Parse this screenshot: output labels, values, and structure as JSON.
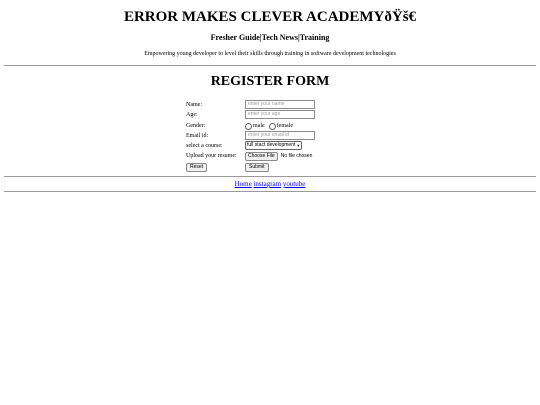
{
  "header": {
    "title": "ERROR MAKES CLEVER ACADEMYðŸš€",
    "nav": [
      "Fresher Guide",
      "Tech News",
      "Training"
    ],
    "nav_separator": "|",
    "tagline": "Empowering young developer to level their skills through training in software development technologies"
  },
  "form": {
    "title": "REGISTER FORM",
    "name": {
      "label": "Name:",
      "placeholder": "enter your name"
    },
    "age": {
      "label": "Age:",
      "placeholder": "enter your age"
    },
    "gender": {
      "label": "Gender:",
      "options": [
        "male",
        "female"
      ]
    },
    "email": {
      "label": "Email id:",
      "placeholder": "enter your email id"
    },
    "course": {
      "label": "select a course:",
      "selected": "full stact development"
    },
    "resume": {
      "label": "Upload your resume:",
      "button": "Choose File",
      "status": "No file chosen"
    },
    "reset_label": "Reset",
    "submit_label": "Submit"
  },
  "footer": {
    "links": [
      "Home",
      "instagram",
      "youtube"
    ]
  }
}
